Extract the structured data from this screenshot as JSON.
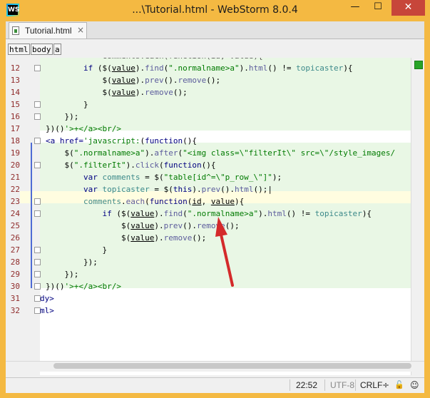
{
  "window": {
    "title": "...\\Tutorial.html - WebStorm 8.0.4",
    "app_icon_letters": "WS",
    "minimize_glyph": "—",
    "maximize_glyph": "☐",
    "close_glyph": "✕"
  },
  "tabs": [
    {
      "label": "Tutorial.html",
      "close_glyph": "×",
      "active": true
    }
  ],
  "breadcrumbs": [
    "html",
    "body",
    "a"
  ],
  "editor": {
    "current_line": 22,
    "lines": [
      {
        "n": "12"
      },
      {
        "n": "13"
      },
      {
        "n": "14"
      },
      {
        "n": "15"
      },
      {
        "n": "16"
      },
      {
        "n": "17"
      },
      {
        "n": "18"
      },
      {
        "n": "19"
      },
      {
        "n": "20"
      },
      {
        "n": "21"
      },
      {
        "n": "22"
      },
      {
        "n": "23"
      },
      {
        "n": "24"
      },
      {
        "n": "25"
      },
      {
        "n": "26"
      },
      {
        "n": "27"
      },
      {
        "n": "28"
      },
      {
        "n": "29"
      },
      {
        "n": "30"
      },
      {
        "n": "31"
      },
      {
        "n": "32"
      }
    ]
  },
  "status": {
    "position": "22:52",
    "encoding": "UTF-8",
    "line_separator": "CRLF",
    "line_separator_arrow": "÷",
    "lock_glyph": "🔓",
    "inspector_glyph": "☺"
  },
  "colors": {
    "title_bar": "#f4b942",
    "close_button": "#c7463a",
    "scope_highlight": "#e9f7e5",
    "current_line": "#fffde0",
    "annotation_arrow": "#d42a2a",
    "status_ok": "#28a428"
  },
  "icons": {
    "app": "webstorm-logo-icon",
    "file": "html-file-icon",
    "status_ok": "no-errors-icon",
    "lock": "read-only-toggle-icon",
    "inspector": "hector-inspector-icon"
  }
}
